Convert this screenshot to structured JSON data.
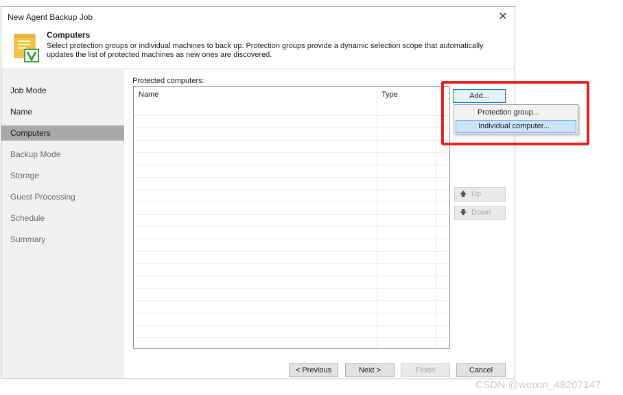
{
  "window": {
    "title": "New Agent Backup Job",
    "close_symbol": "✕"
  },
  "header": {
    "icon": "veeam-scroll-icon",
    "title": "Computers",
    "description": "Select protection groups or individual machines to back up. Protection groups provide a dynamic selection scope that automatically updates the list of protected machines as new ones are discovered."
  },
  "sidebar": {
    "items": [
      {
        "label": "Job Mode",
        "state": "done"
      },
      {
        "label": "Name",
        "state": "done"
      },
      {
        "label": "Computers",
        "state": "active"
      },
      {
        "label": "Backup Mode",
        "state": "future"
      },
      {
        "label": "Storage",
        "state": "future"
      },
      {
        "label": "Guest Processing",
        "state": "future"
      },
      {
        "label": "Schedule",
        "state": "future"
      },
      {
        "label": "Summary",
        "state": "future"
      }
    ]
  },
  "main": {
    "list_label": "Protected computers:",
    "columns": [
      "Name",
      "Type"
    ],
    "rows": []
  },
  "buttons": {
    "add": "Add...",
    "up": "Up",
    "down": "Down",
    "up_icon": "arrow-up-icon",
    "down_icon": "arrow-down-icon"
  },
  "add_menu": {
    "items": [
      "Protection group...",
      "Individual computer..."
    ],
    "highlighted": "Individual computer..."
  },
  "footer": {
    "previous": "< Previous",
    "next": "Next >",
    "finish": "Finish",
    "cancel": "Cancel"
  },
  "annotation": {
    "color": "#e8201e"
  },
  "watermark": "CSDN @weixin_48207147"
}
